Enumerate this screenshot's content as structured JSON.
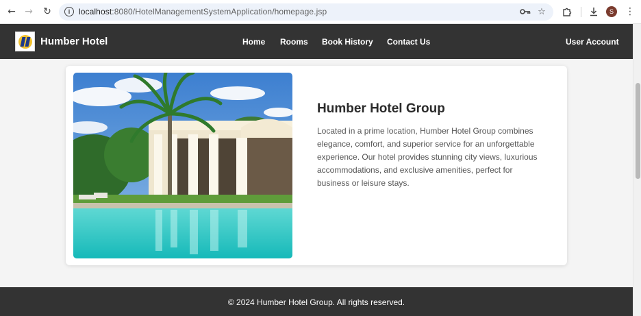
{
  "browser": {
    "url_host": "localhost",
    "url_path": ":8080/HotelManagementSystemApplication/homepage.jsp",
    "icons": {
      "back": "back-arrow-icon",
      "forward": "forward-arrow-icon",
      "reload": "reload-icon",
      "site_info": "site-info-icon",
      "password_key": "password-key-icon",
      "bookmark": "star-icon",
      "extensions": "puzzle-icon",
      "downloads": "download-icon",
      "menu": "kebab-menu-icon"
    },
    "profile_initial": "S"
  },
  "header": {
    "brand": "Humber Hotel",
    "menu": [
      "Home",
      "Rooms",
      "Book History",
      "Contact Us"
    ],
    "user_account": "User Account"
  },
  "card": {
    "title": "Humber Hotel Group",
    "text": "Located in a prime location, Humber Hotel Group combines elegance, comfort, and superior service for an unforgettable experience. Our hotel provides stunning city views, luxurious accommodations, and exclusive amenities, perfect for business or leisure stays."
  },
  "footer": {
    "text": "© 2024 Humber Hotel Group. All rights reserved."
  },
  "colors": {
    "header_bg": "#333333",
    "page_bg": "#f4f4f4",
    "card_bg": "#ffffff",
    "pool": "#27c6c3",
    "sky": "#4a8fd6"
  }
}
